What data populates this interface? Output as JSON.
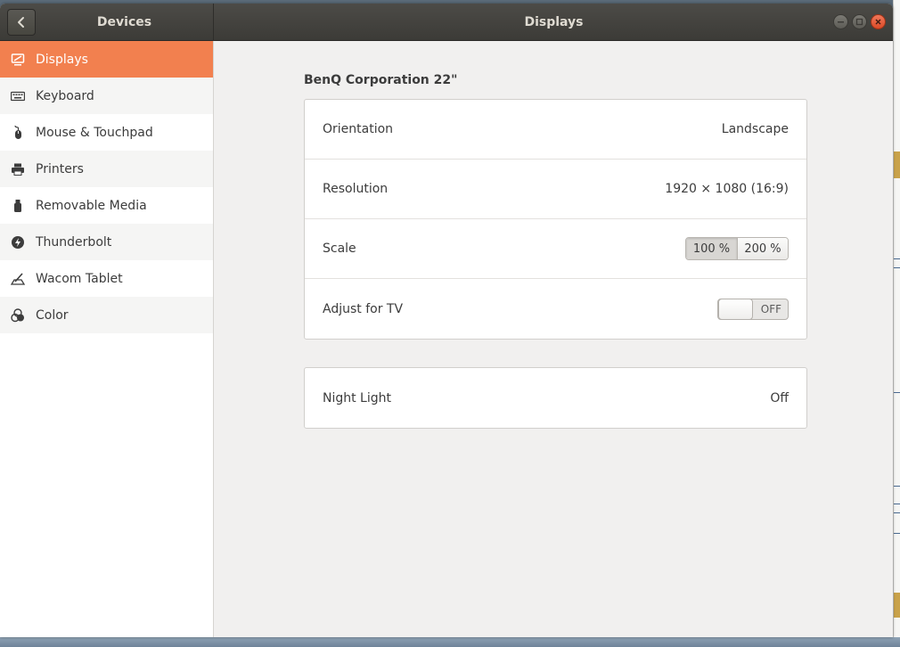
{
  "window": {
    "sidebar_title": "Devices",
    "main_title": "Displays"
  },
  "sidebar": {
    "items": [
      {
        "label": "Displays",
        "icon": "display-icon",
        "active": true
      },
      {
        "label": "Keyboard",
        "icon": "keyboard-icon"
      },
      {
        "label": "Mouse & Touchpad",
        "icon": "mouse-icon"
      },
      {
        "label": "Printers",
        "icon": "printer-icon"
      },
      {
        "label": "Removable Media",
        "icon": "usb-drive-icon"
      },
      {
        "label": "Thunderbolt",
        "icon": "thunderbolt-icon"
      },
      {
        "label": "Wacom Tablet",
        "icon": "tablet-icon"
      },
      {
        "label": "Color",
        "icon": "color-icon"
      }
    ]
  },
  "display": {
    "monitor_name": "BenQ Corporation 22\"",
    "orientation": {
      "label": "Orientation",
      "value": "Landscape"
    },
    "resolution": {
      "label": "Resolution",
      "value": "1920 × 1080 (16:9)"
    },
    "scale": {
      "label": "Scale",
      "options": [
        "100 %",
        "200 %"
      ],
      "selected": "100 %"
    },
    "adjust_tv": {
      "label": "Adjust for TV",
      "state": "OFF"
    },
    "night_light": {
      "label": "Night Light",
      "value": "Off"
    }
  },
  "colors": {
    "accent": "#f2804f",
    "titlebar": "#3c3b37",
    "close": "#dc4a27"
  }
}
